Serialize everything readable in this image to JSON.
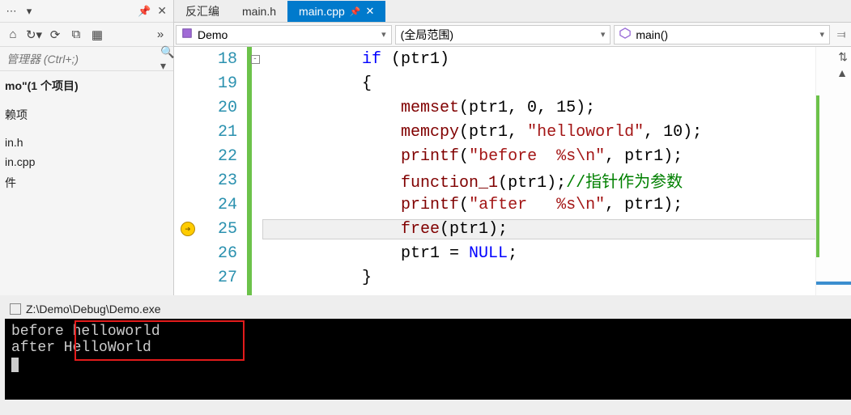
{
  "sidebar": {
    "search_placeholder": "管理器 (Ctrl+;)",
    "solution_label": "mo\"(1 个项目)",
    "items": [
      "",
      "赖项",
      "",
      "in.h",
      "in.cpp",
      "件"
    ]
  },
  "tabs": [
    {
      "label": "反汇编",
      "active": false
    },
    {
      "label": "main.h",
      "active": false
    },
    {
      "label": "main.cpp",
      "active": true
    }
  ],
  "nav": {
    "project": "Demo",
    "scope": "(全局范围)",
    "function": "main()"
  },
  "code": {
    "lines": [
      {
        "n": 18,
        "html": "<span class='kw-blue'>if</span> (ptr1)",
        "indent": 2
      },
      {
        "n": 19,
        "html": "{",
        "indent": 2
      },
      {
        "n": 20,
        "html": "<span class='fn'>memset</span>(ptr1, 0, 15);",
        "indent": 3
      },
      {
        "n": 21,
        "html": "<span class='fn'>memcpy</span>(ptr1, <span class='str'>\"helloworld\"</span>, 10);",
        "indent": 3
      },
      {
        "n": 22,
        "html": "<span class='fn'>printf</span>(<span class='str'>\"before  %s\\n\"</span>, ptr1);",
        "indent": 3
      },
      {
        "n": 23,
        "html": "<span class='fn'>function_1</span>(ptr1);<span class='cmt'>//指针作为参数</span>",
        "indent": 3
      },
      {
        "n": 24,
        "html": "<span class='fn'>printf</span>(<span class='str'>\"after   %s\\n\"</span>, ptr1);",
        "indent": 3
      },
      {
        "n": 25,
        "html": "<span class='fn'>free</span>(ptr1);",
        "indent": 3,
        "current": true
      },
      {
        "n": 26,
        "html": "ptr1 = <span class='null'>NULL</span>;",
        "indent": 3
      },
      {
        "n": 27,
        "html": "}",
        "indent": 2
      }
    ]
  },
  "console": {
    "title": "Z:\\Demo\\Debug\\Demo.exe",
    "lines": [
      "before  helloworld",
      "after   HelloWorld"
    ]
  }
}
